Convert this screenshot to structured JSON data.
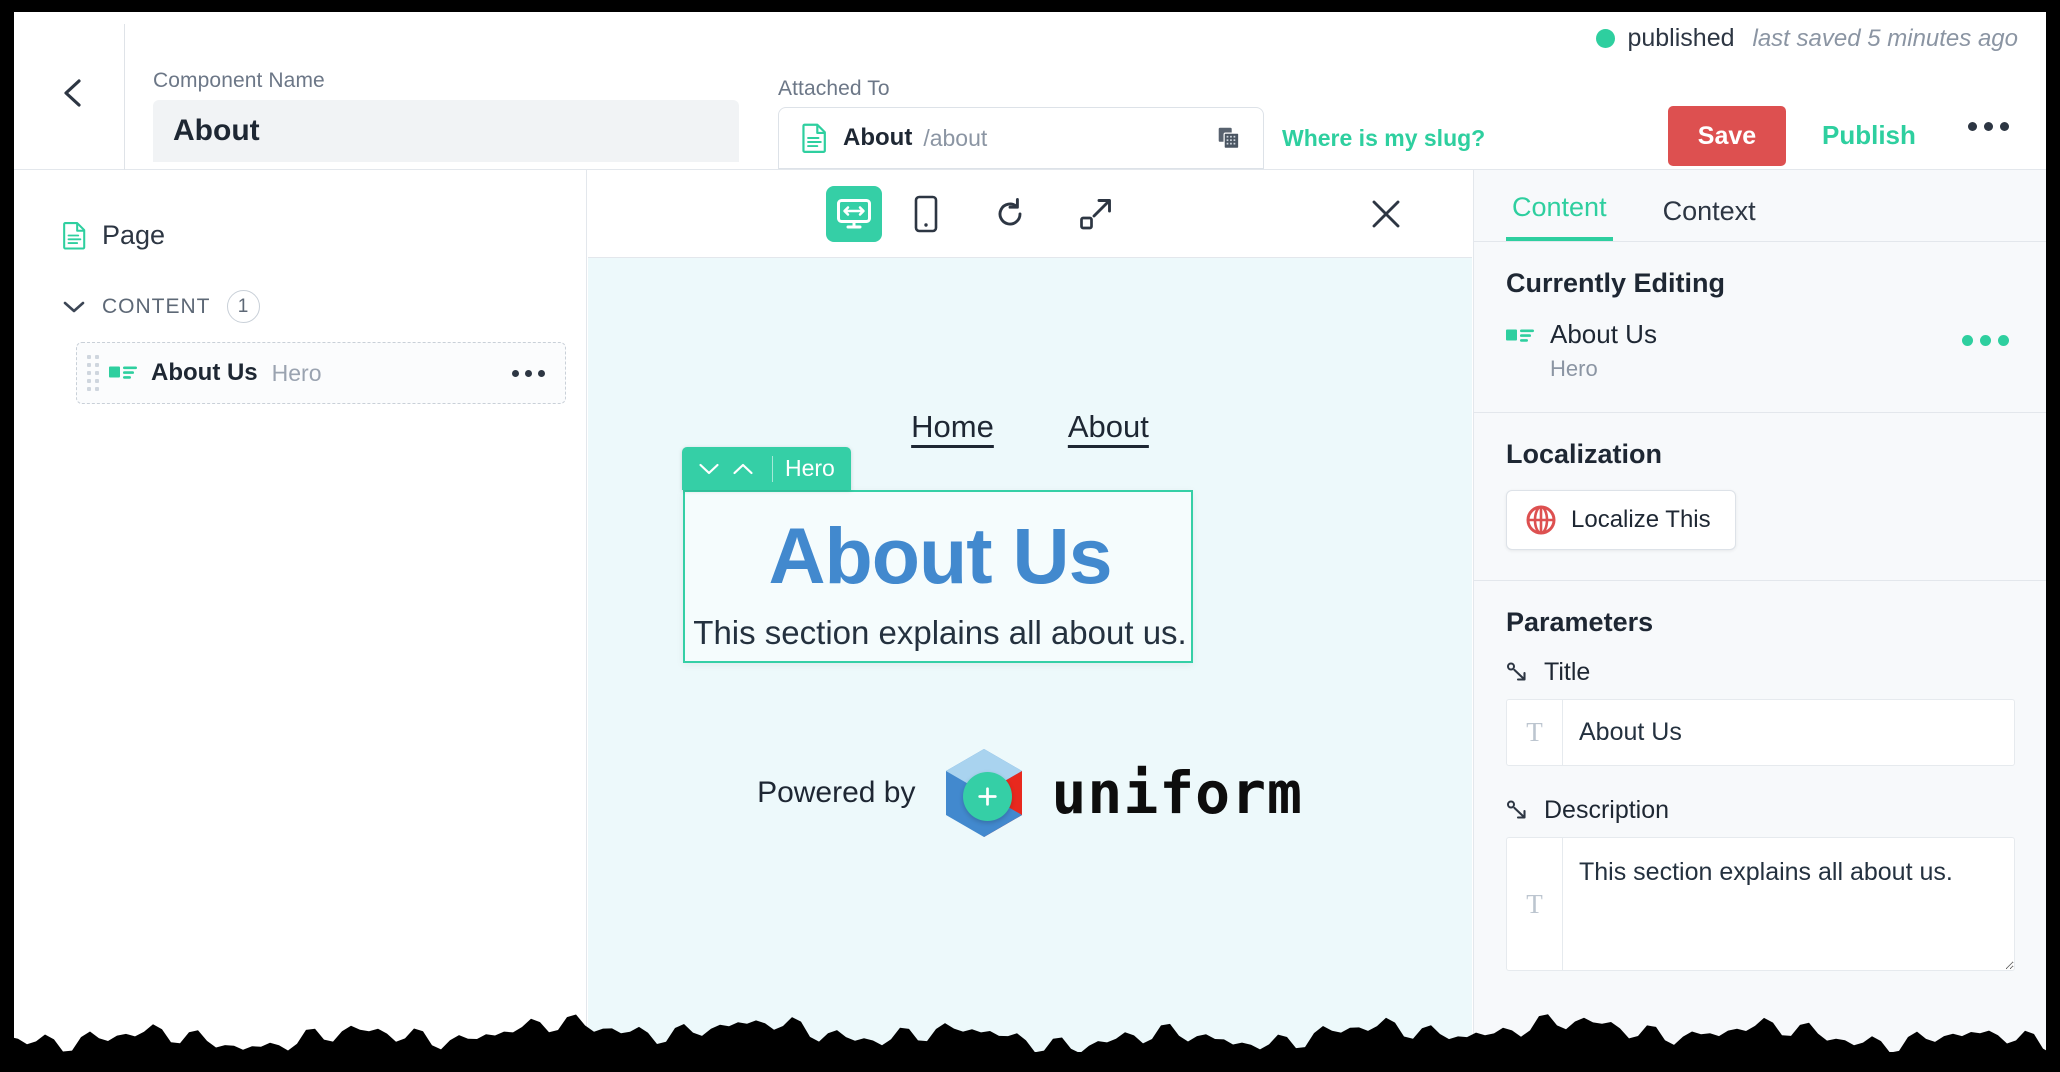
{
  "header": {
    "back_icon": "chevron-left-icon",
    "component_name_label": "Component Name",
    "component_name_value": "About",
    "component_name_placeholder": "Component Name",
    "attached_to_label": "Attached To",
    "attached_doc_icon": "document-icon",
    "attached_name": "About",
    "attached_slug": "/about",
    "attached_copy_icon": "copy-icon",
    "slug_link": "Where is my slug?",
    "status": "published",
    "status_color": "#2ecf9f",
    "last_saved": "last saved 5 minutes ago",
    "save_label": "Save",
    "save_color": "#dd5050",
    "publish_label": "Publish",
    "more_icon": "ellipsis-icon"
  },
  "sidebar": {
    "page_icon": "page-document-icon",
    "page_label": "Page",
    "content_collapse_icon": "chevron-down-icon",
    "content_title": "CONTENT",
    "content_count": "1",
    "items": [
      {
        "drag_icon": "drag-handle-icon",
        "component_icon": "component-icon",
        "name": "About Us",
        "type": "Hero",
        "more_icon": "ellipsis-icon"
      }
    ]
  },
  "canvas": {
    "toolbar": {
      "desktop_icon": "desktop-responsive-icon",
      "mobile_icon": "mobile-device-icon",
      "refresh_icon": "refresh-icon",
      "expand_icon": "expand-arrow-icon",
      "close_icon": "close-icon",
      "active_device": "desktop",
      "active_color": "#35cfa6"
    },
    "preview": {
      "nav_links": [
        "Home",
        "About"
      ],
      "component_badge": {
        "move_down_icon": "chevron-down-icon",
        "move_up_icon": "chevron-up-icon",
        "label": "Hero",
        "color": "#35cfa6"
      },
      "hero_title": "About Us",
      "hero_title_color": "#4289ce",
      "hero_description": "This section explains all about us.",
      "add_component_icon": "plus-icon",
      "powered_by_text": "Powered by",
      "brand_logo_icon": "uniform-hexagon-logo",
      "brand_name": "uniform"
    }
  },
  "right_panel": {
    "tabs": [
      {
        "label": "Content",
        "active": true
      },
      {
        "label": "Context",
        "active": false
      }
    ],
    "currently_editing": {
      "title": "Currently Editing",
      "component_icon": "component-icon",
      "name": "About Us",
      "type": "Hero",
      "more_icon": "ellipsis-icon"
    },
    "localization": {
      "title": "Localization",
      "globe_icon": "globe-icon",
      "button_label": "Localize This",
      "globe_color": "#dd5050"
    },
    "parameters": {
      "title": "Parameters",
      "fields": [
        {
          "label": "Title",
          "param_icon": "parameter-arrow-icon",
          "type_icon": "text-type-icon",
          "value": "About Us",
          "placeholder": "Title"
        },
        {
          "label": "Description",
          "param_icon": "parameter-arrow-icon",
          "type_icon": "text-type-icon",
          "value": "This section explains all about us.",
          "placeholder": "Description"
        }
      ]
    }
  }
}
